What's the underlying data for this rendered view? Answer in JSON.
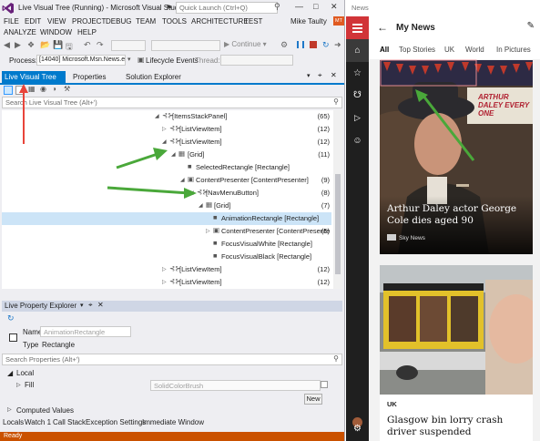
{
  "vs": {
    "title": "Live Visual Tree (Running) - Microsoft Visual Studio",
    "quick_launch_placeholder": "Quick Launch (Ctrl+Q)",
    "user": "Mike Taulty",
    "user_badge": "MT",
    "menu": {
      "row1": [
        "FILE",
        "EDIT",
        "VIEW",
        "PROJECT",
        "DEBUG",
        "TEAM",
        "TOOLS",
        "ARCHITECTURE",
        "TEST"
      ],
      "row2": [
        "ANALYZE",
        "WINDOW",
        "HELP"
      ]
    },
    "toolbar": {
      "continue": "Continue"
    },
    "process_bar": {
      "process_label": "Process:",
      "process_value": "[14040] Microsoft.Msn.News.ex",
      "lifecycle": "Lifecycle Events",
      "thread_label": "Thread:"
    },
    "tabs": [
      "Live Visual Tree",
      "Properties",
      "Solution Explorer"
    ],
    "lvt_search_placeholder": "Search Live Visual Tree (Alt+')",
    "tree_rows": [
      {
        "label": "[ItemsStackPanel]",
        "count": "(65)"
      },
      {
        "label": "[ListViewItem]",
        "count": "(12)"
      },
      {
        "label": "[ListViewItem]",
        "count": "(12)"
      },
      {
        "label": "[Grid]",
        "count": "(11)"
      },
      {
        "label": "SelectedRectangle [Rectangle]",
        "count": ""
      },
      {
        "label": "ContentPresenter [ContentPresenter]",
        "count": "(9)"
      },
      {
        "label": "[NavMenuButton]",
        "count": "(8)"
      },
      {
        "label": "[Grid]",
        "count": "(7)"
      },
      {
        "label": "AnimationRectangle [Rectangle]",
        "count": ""
      },
      {
        "label": "ContentPresenter [ContentPresente",
        "count": "(5)"
      },
      {
        "label": "FocusVisualWhite [Rectangle]",
        "count": ""
      },
      {
        "label": "FocusVisualBlack [Rectangle]",
        "count": ""
      },
      {
        "label": "[ListViewItem]",
        "count": "(12)"
      },
      {
        "label": "[ListViewItem]",
        "count": "(12)"
      }
    ],
    "property_explorer": {
      "title": "Live Property Explorer",
      "name_label": "Name",
      "name_placeholder": "AnimationRectangle",
      "type_label": "Type",
      "type_value": "Rectangle",
      "search_placeholder": "Search Properties (Alt+')",
      "local_label": "Local",
      "fill_label": "Fill",
      "fill_value": "SolidColorBrush",
      "new_button": "New",
      "computed_label": "Computed Values"
    },
    "bottom_tabs": [
      "Locals",
      "Watch 1",
      "Call Stack",
      "Exception Settings",
      "Immediate Window"
    ],
    "status": "Ready"
  },
  "news": {
    "window_title": "News",
    "header_title": "My News",
    "tabs": [
      "All",
      "Top Stories",
      "UK",
      "World",
      "In Pictures"
    ],
    "hero": {
      "banner_text": "ARTHUR DALEY EVERY ONE",
      "title": "Arthur Daley actor George Cole dies aged 90",
      "source": "Sky News"
    },
    "card2": {
      "tag": "UK",
      "title": "Glasgow bin lorry crash driver suspended"
    }
  },
  "colors": {
    "vs_accent": "#007acc",
    "vs_status": "#ca5100",
    "news_accent": "#d13438",
    "annotation_green": "#4aa83a",
    "annotation_red": "#e8443a"
  }
}
